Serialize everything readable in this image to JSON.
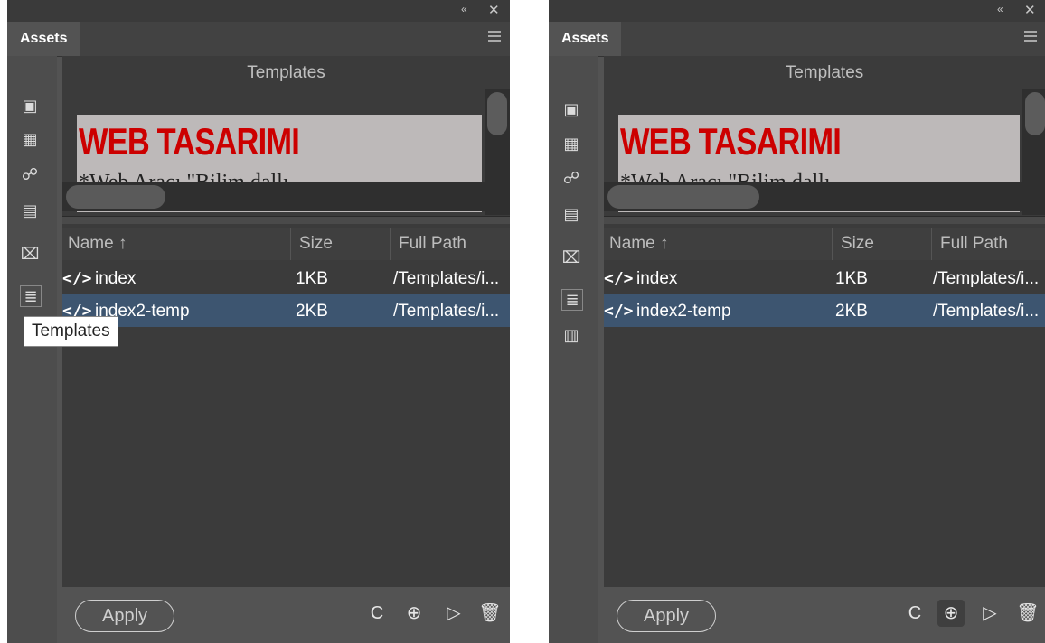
{
  "panel_title": "Assets",
  "preview": {
    "title": "Templates",
    "heading": "WEB TASARIMI",
    "subtext": "*Web Aracı \"Bilim dallı..."
  },
  "columns": {
    "name": "Name",
    "sort_arrow": "↑",
    "size": "Size",
    "path": "Full Path"
  },
  "rows": [
    {
      "name": "index",
      "size": "1KB",
      "path": "/Templates/i..."
    },
    {
      "name": "index2-temp",
      "size": "2KB",
      "path": "/Templates/i..."
    }
  ],
  "apply_label": "Apply",
  "tooltip": "Templates",
  "icons": {
    "collapse": "«",
    "close": "✕",
    "code": "</>",
    "refresh": "C",
    "new_template": "⊕",
    "edit": "▷",
    "delete": "🗑"
  },
  "colors": {
    "selected_row": "#3d5570",
    "heading_red": "#cc0000",
    "panel_bg": "#535353"
  }
}
